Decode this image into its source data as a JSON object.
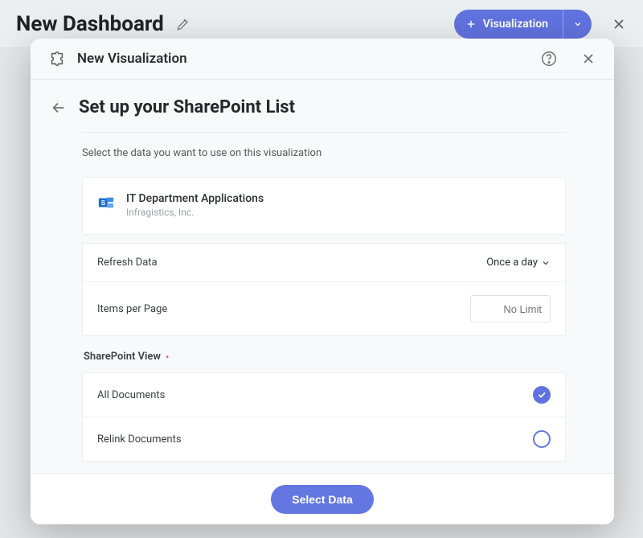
{
  "dashboard": {
    "title": "New Dashboard",
    "visualization_button": "Visualization"
  },
  "modal": {
    "title": "New Visualization",
    "setup_title": "Set up your SharePoint List",
    "description": "Select the data you want to use on this visualization",
    "source": {
      "name": "IT Department Applications",
      "subtitle": "Infragistics, Inc."
    },
    "settings": {
      "refresh_label": "Refresh Data",
      "refresh_value": "Once a day",
      "items_label": "Items per Page",
      "items_placeholder": "No Limit"
    },
    "view_section_label": "SharePoint View",
    "views": [
      {
        "label": "All Documents",
        "selected": true
      },
      {
        "label": "Relink Documents",
        "selected": false
      }
    ],
    "footer": {
      "select_button": "Select Data"
    }
  }
}
